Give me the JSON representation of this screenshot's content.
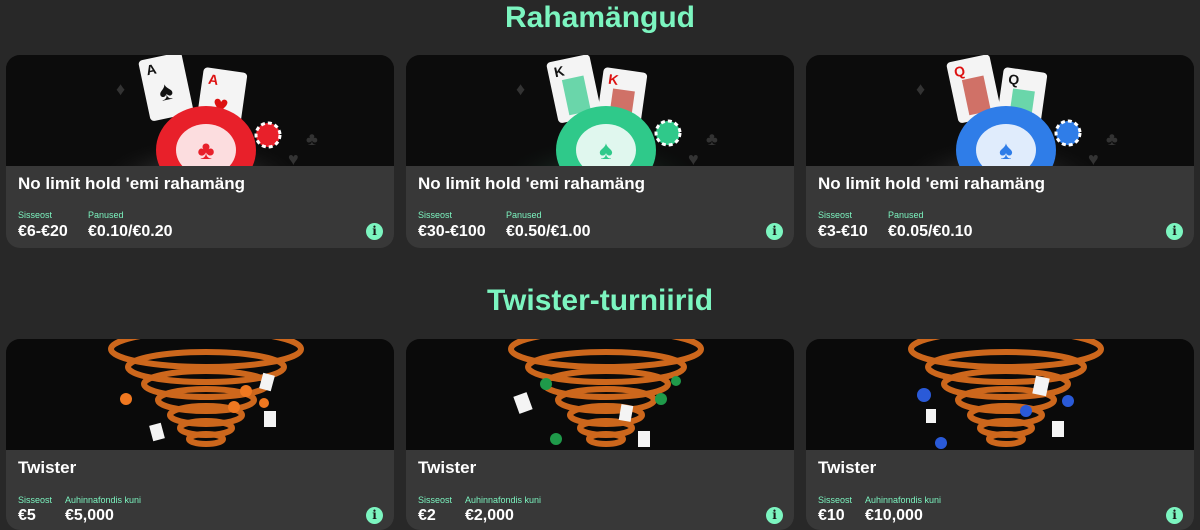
{
  "sections": {
    "cash": {
      "title": "Rahamängud",
      "cards": [
        {
          "title": "No limit hold 'emi rahamäng",
          "buyin_label": "Sisseost",
          "buyin": "€6-€20",
          "stakes_label": "Panused",
          "stakes": "€0.10/€0.20",
          "chip_color": "#e8202a",
          "info_icon": "info-icon",
          "info_glyph": "i"
        },
        {
          "title": "No limit hold 'emi rahamäng",
          "buyin_label": "Sisseost",
          "buyin": "€30-€100",
          "stakes_label": "Panused",
          "stakes": "€0.50/€1.00",
          "chip_color": "#2fc98a",
          "info_icon": "info-icon",
          "info_glyph": "i"
        },
        {
          "title": "No limit hold 'emi rahamäng",
          "buyin_label": "Sisseost",
          "buyin": "€3-€10",
          "stakes_label": "Panused",
          "stakes": "€0.05/€0.10",
          "chip_color": "#2f7de8",
          "info_icon": "info-icon",
          "info_glyph": "i"
        }
      ]
    },
    "twister": {
      "title": "Twister-turniirid",
      "cards": [
        {
          "title": "Twister",
          "buyin_label": "Sisseost",
          "buyin": "€5",
          "prize_label": "Auhinnafondis kuni",
          "prize": "€5,000",
          "chip_color": "#f07820",
          "info_icon": "info-icon",
          "info_glyph": "i"
        },
        {
          "title": "Twister",
          "buyin_label": "Sisseost",
          "buyin": "€2",
          "prize_label": "Auhinnafondis kuni",
          "prize": "€2,000",
          "chip_color": "#1f9a4a",
          "info_icon": "info-icon",
          "info_glyph": "i"
        },
        {
          "title": "Twister",
          "buyin_label": "Sisseost",
          "buyin": "€10",
          "prize_label": "Auhinnafondis kuni",
          "prize": "€10,000",
          "chip_color": "#2a5ad8",
          "info_icon": "info-icon",
          "info_glyph": "i"
        }
      ]
    }
  },
  "colors": {
    "accent": "#7cf5c0",
    "card_bg": "#383838",
    "page_bg": "#282828"
  }
}
